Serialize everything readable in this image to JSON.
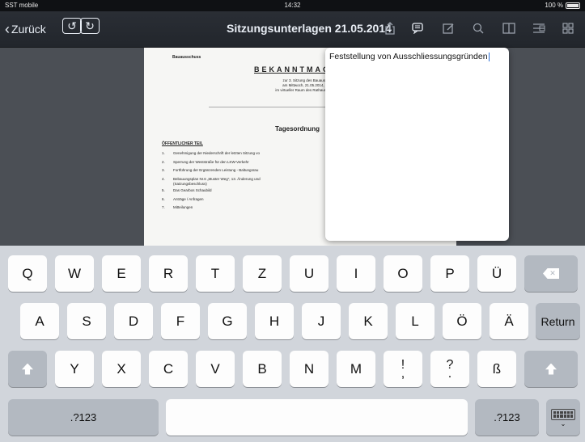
{
  "status_bar": {
    "carrier": "SST mobile",
    "time": "14:32",
    "battery": "100 %"
  },
  "navbar": {
    "back_label": "Zurück",
    "title": "Sitzungsunterlagen 21.05.2014",
    "icons": [
      "share-icon",
      "notes-icon",
      "edit-icon",
      "search-icon",
      "book-icon",
      "list-icon",
      "grid-icon"
    ]
  },
  "document": {
    "committee": "Bauausschuss",
    "heading": "BEKANNTMACH",
    "sub_lines": [
      "zur 3. Sitzung des Bauaussc",
      "am Mittwoch, 21.05.2014, 18",
      "im virtueller Raum des Rathauses der"
    ],
    "agenda_title": "Tagesordnung",
    "section": "ÖFFENTLICHER TEIL",
    "items": [
      {
        "n": "1.",
        "text": "Genehmigung der Niederschrift der letzten Sitzung vo"
      },
      {
        "n": "2.",
        "text": "Sperrung der Weststraße für den LKW-Verkehr"
      },
      {
        "n": "3.",
        "text": "Fortführung der Ergänzenden Leistung - Baltungsrau"
      },
      {
        "n": "4.",
        "text": "Bebauungsplan Nr.6 „Muster Weg\", 13. Änderung und"
      },
      {
        "n": "",
        "text": "(Satzungsbeschluss)"
      },
      {
        "n": "5.",
        "text": "Das Gearbos Schaubild"
      },
      {
        "n": "6.",
        "text": "Anträge / Anfragen"
      },
      {
        "n": "7.",
        "text": "Mitteilungen"
      }
    ]
  },
  "notepad": {
    "text": "Feststellung von Ausschliessungsgründen"
  },
  "keyboard": {
    "row1": [
      "Q",
      "W",
      "E",
      "R",
      "T",
      "Z",
      "U",
      "I",
      "O",
      "P",
      "Ü"
    ],
    "row2": [
      "A",
      "S",
      "D",
      "F",
      "G",
      "H",
      "J",
      "K",
      "L",
      "Ö",
      "Ä"
    ],
    "return_label": "Return",
    "row3": [
      "Y",
      "X",
      "C",
      "V",
      "B",
      "N",
      "M"
    ],
    "row3_punct": [
      {
        "top": "!",
        "bottom": ","
      },
      {
        "top": "?",
        "bottom": "."
      }
    ],
    "row3_sz": "ß",
    "numbers_label": ".?123"
  }
}
